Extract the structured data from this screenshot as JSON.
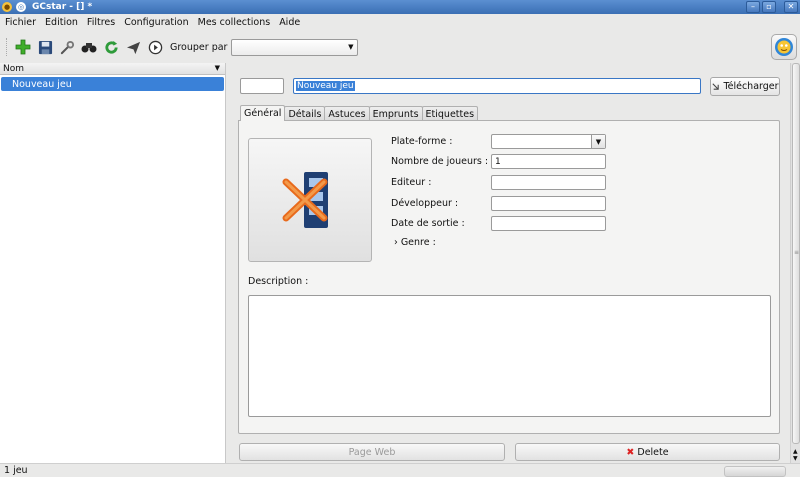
{
  "window": {
    "title": "GCstar - [] *",
    "minimize_label": "–",
    "maximize_label": "▫",
    "close_label": "✕"
  },
  "menu": {
    "items": [
      "Fichier",
      "Edition",
      "Filtres",
      "Configuration",
      "Mes collections",
      "Aide"
    ]
  },
  "toolbar": {
    "group_by_label": "Grouper par",
    "group_by_value": ""
  },
  "list": {
    "column_header": "Nom",
    "items": [
      "Nouveau jeu"
    ]
  },
  "item": {
    "id_value": "",
    "title_value": "Nouveau jeu",
    "download_label": "Télécharger"
  },
  "tabs": [
    "Général",
    "Détails",
    "Astuces",
    "Emprunts",
    "Etiquettes"
  ],
  "general": {
    "platform_label": "Plate-forme :",
    "platform_value": "",
    "players_label": "Nombre de joueurs :",
    "players_value": "1",
    "editor_label": "Editeur :",
    "editor_value": "",
    "developer_label": "Développeur :",
    "developer_value": "",
    "release_label": "Date de sortie :",
    "release_value": "",
    "genre_label": "Genre :",
    "description_label": "Description :"
  },
  "buttons": {
    "webpage_label": "Page Web",
    "delete_label": "Delete"
  },
  "status": {
    "text": "1 jeu"
  },
  "colors": {
    "selection": "#3a81d8",
    "titlebar": "#3a6fb4",
    "delete_icon": "#d22222"
  }
}
